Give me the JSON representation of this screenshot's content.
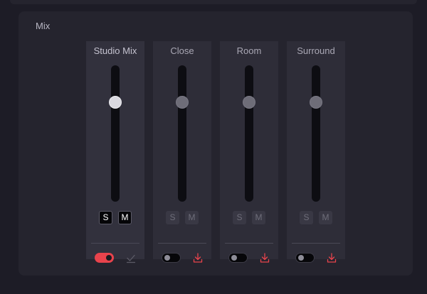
{
  "panel": {
    "title": "Mix"
  },
  "channels": [
    {
      "name": "Studio Mix",
      "level": 0.73,
      "active": true,
      "solo_label": "S",
      "mute_label": "M",
      "toggle_on": true,
      "action_icon": "check-icon"
    },
    {
      "name": "Close",
      "level": 0.73,
      "active": false,
      "solo_label": "S",
      "mute_label": "M",
      "toggle_on": false,
      "action_icon": "download-icon"
    },
    {
      "name": "Room",
      "level": 0.73,
      "active": false,
      "solo_label": "S",
      "mute_label": "M",
      "toggle_on": false,
      "action_icon": "download-icon"
    },
    {
      "name": "Surround",
      "level": 0.73,
      "active": false,
      "solo_label": "S",
      "mute_label": "M",
      "toggle_on": false,
      "action_icon": "download-icon"
    }
  ],
  "colors": {
    "accent": "#e8434c",
    "background": "#1d1c26",
    "panel": "#25242e"
  }
}
